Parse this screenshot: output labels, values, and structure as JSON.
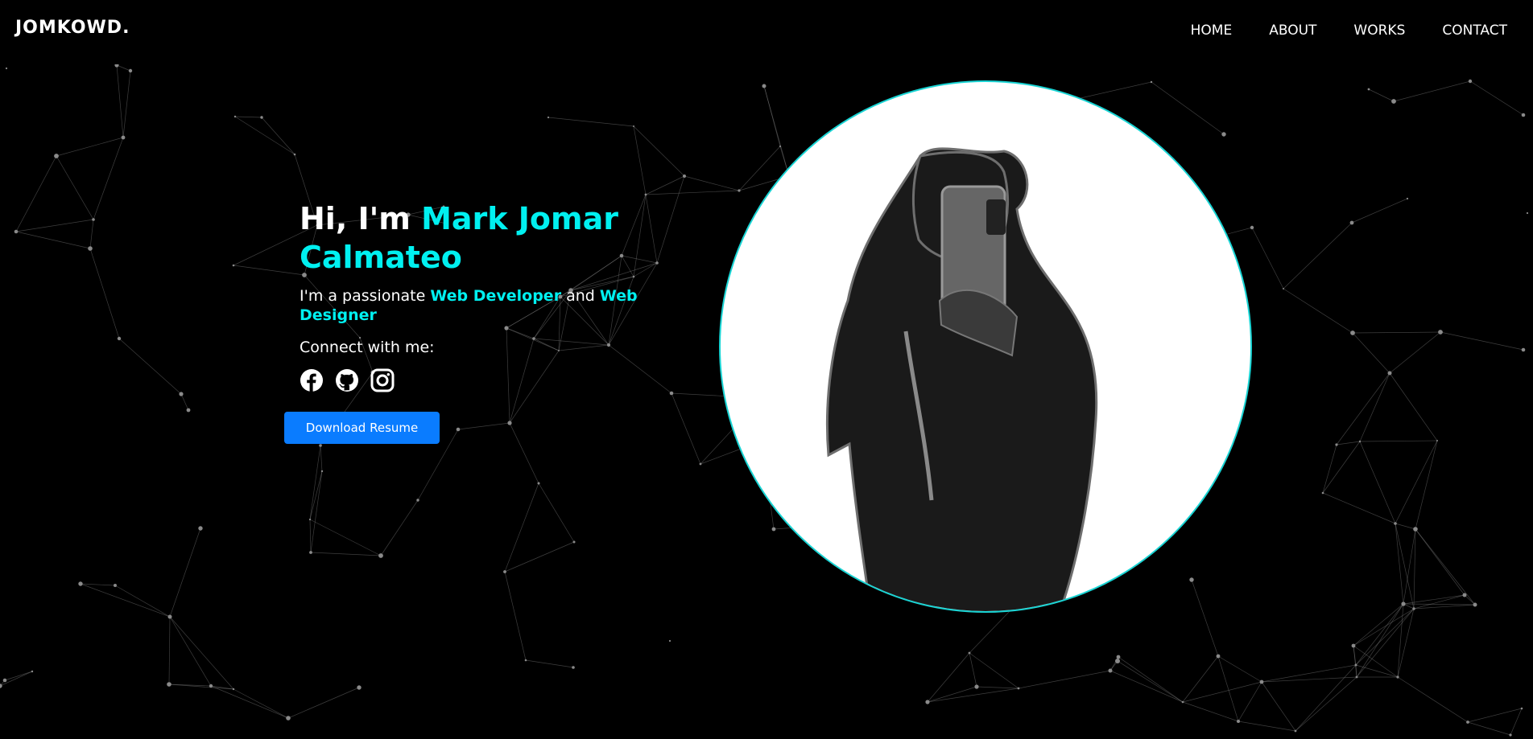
{
  "brand": {
    "logo": "JOMKOWD."
  },
  "nav": [
    {
      "label": "HOME"
    },
    {
      "label": "ABOUT"
    },
    {
      "label": "WORKS"
    },
    {
      "label": "CONTACT"
    }
  ],
  "hero": {
    "greeting": "Hi, I'm ",
    "name": "Mark Jomar Calmateo",
    "tagline_prefix": "I'm a passionate ",
    "role1": "Web Developer",
    "tagline_and": " and ",
    "role2": "Web Designer",
    "connect": "Connect with me:",
    "socials": [
      {
        "icon": "facebook-icon"
      },
      {
        "icon": "github-icon"
      },
      {
        "icon": "instagram-icon"
      }
    ],
    "button": "Download Resume"
  },
  "colors": {
    "background": "#000000",
    "accent": "#00f0f0",
    "button": "#0a7cff",
    "portrait_ring": "#19d4d4",
    "network": "#8a8a8a"
  }
}
